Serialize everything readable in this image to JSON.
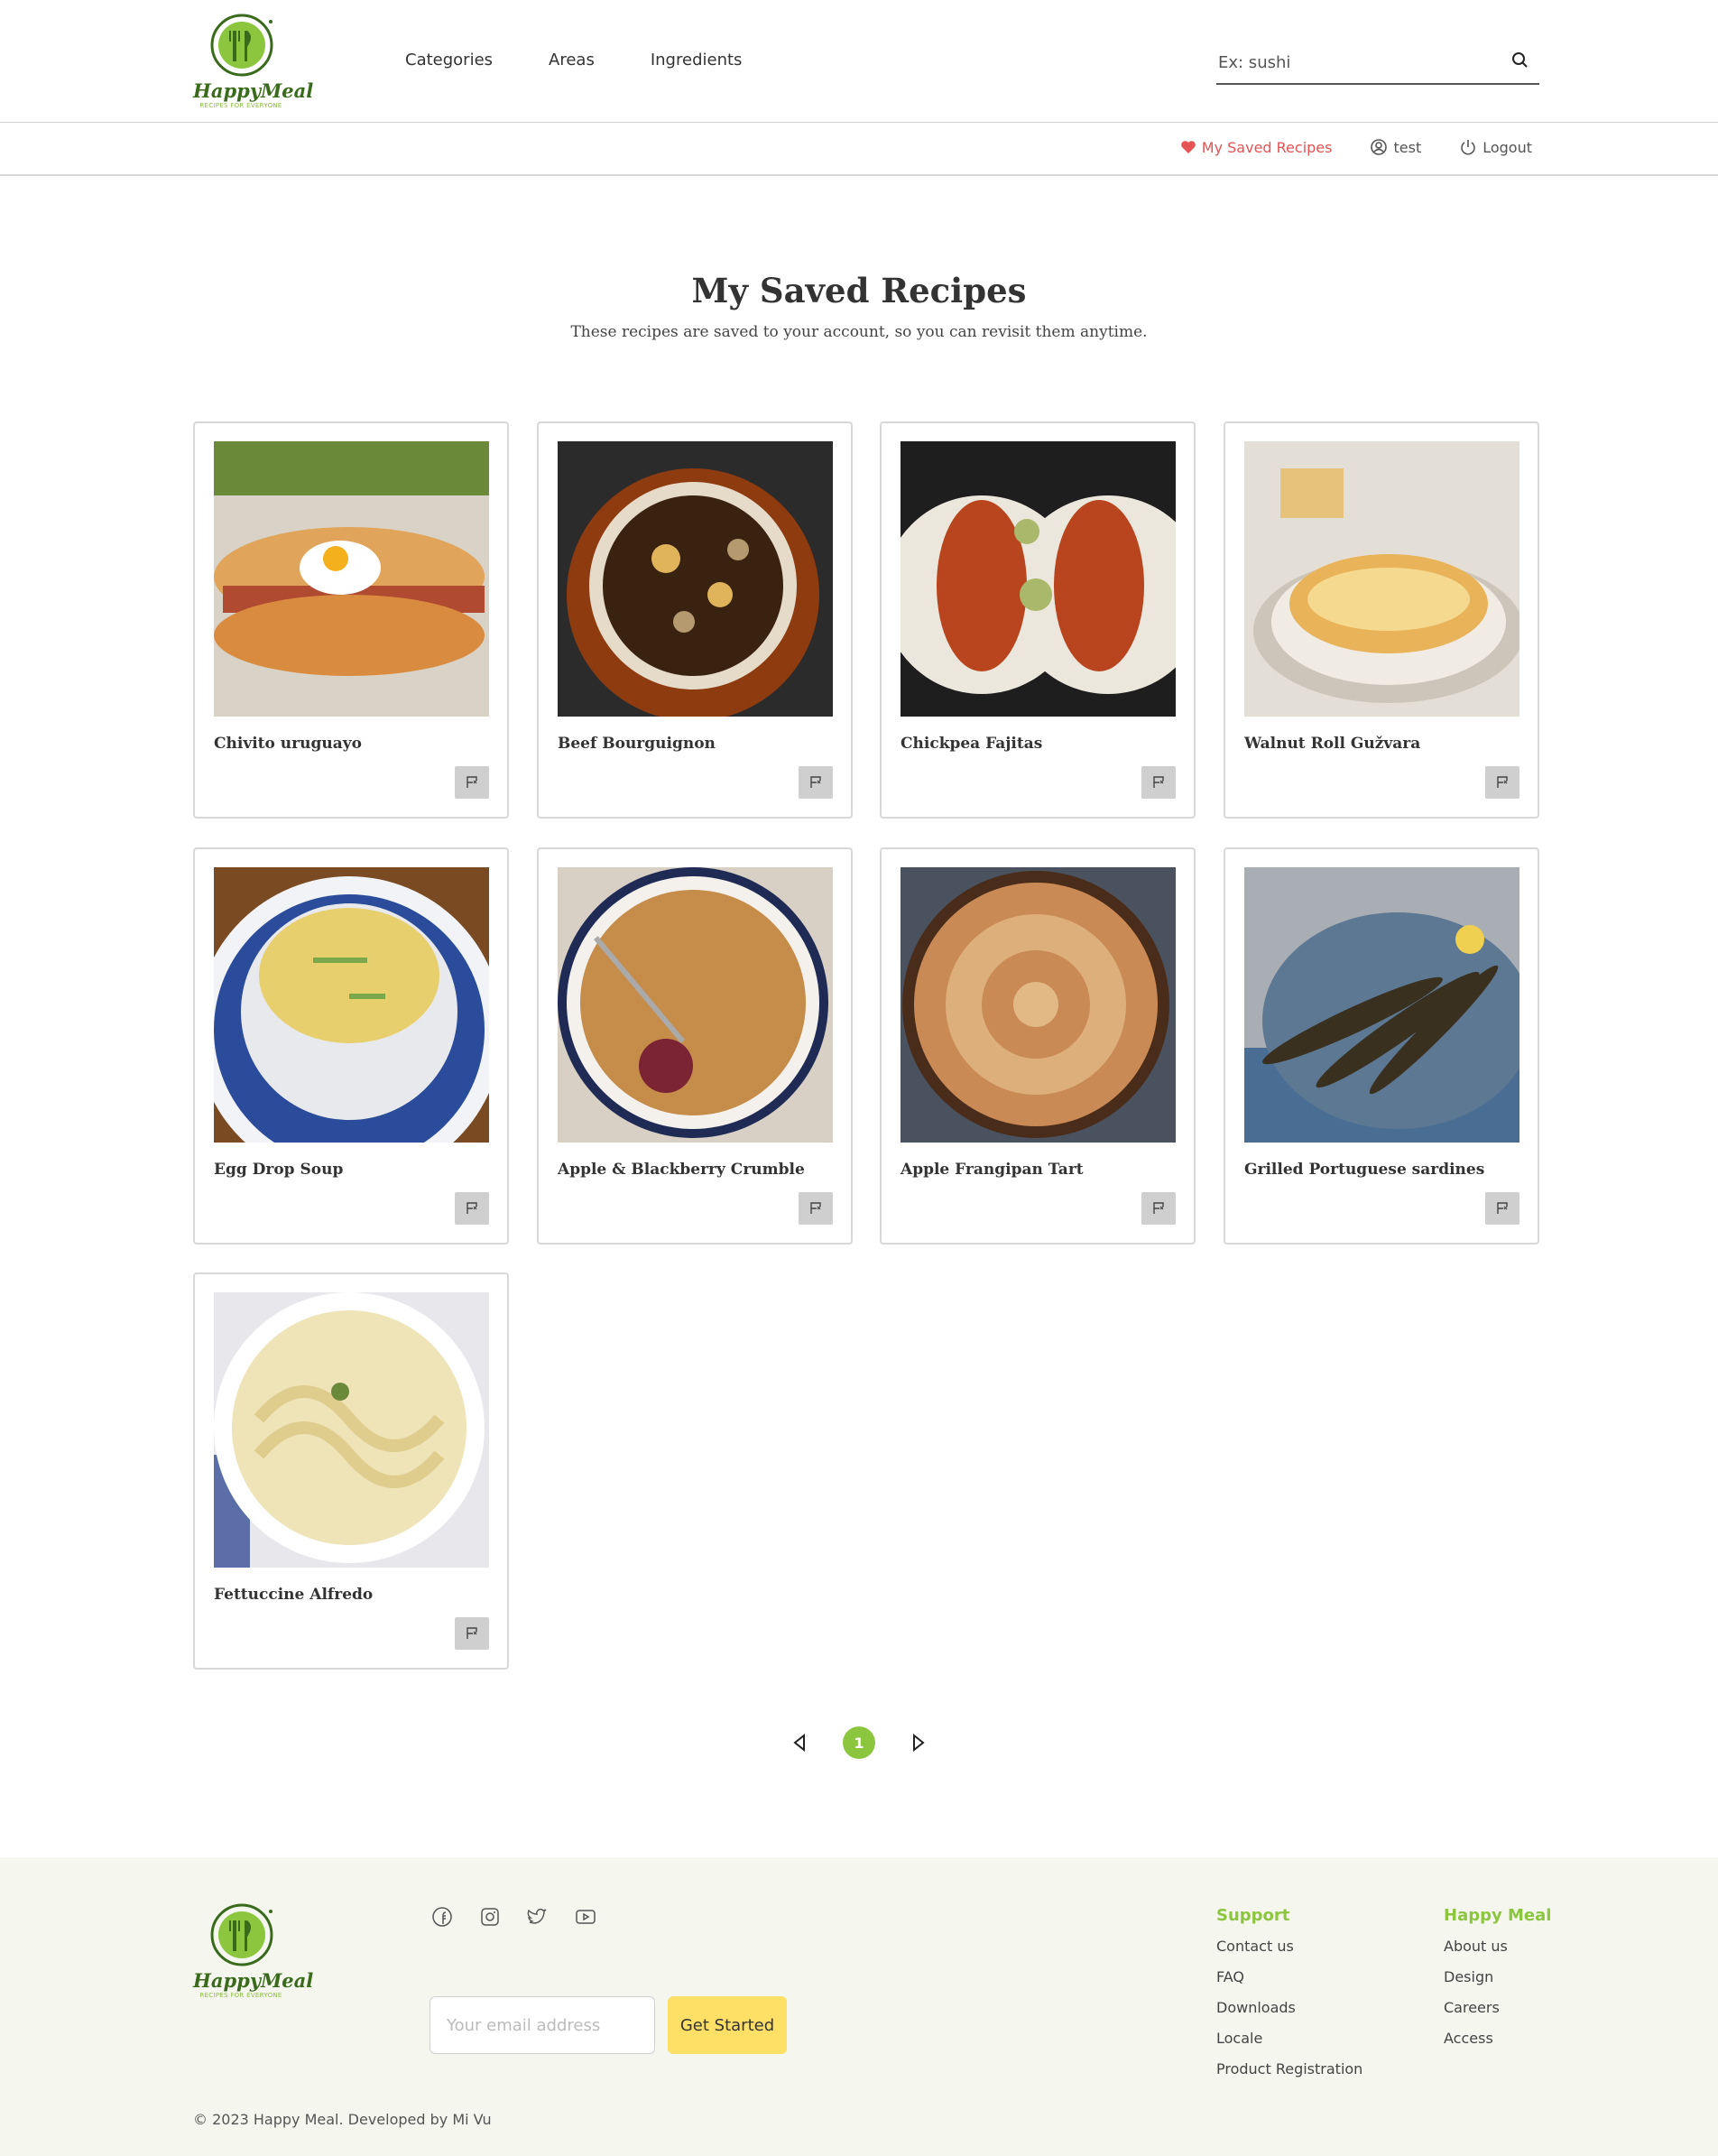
{
  "brand": {
    "name": "HappyMeal",
    "tagline": "RECIPES FOR EVERYONE"
  },
  "nav": [
    "Categories",
    "Areas",
    "Ingredients"
  ],
  "search": {
    "placeholder": "Ex: sushi"
  },
  "subnav": {
    "saved": "My Saved Recipes",
    "user": "test",
    "logout": "Logout"
  },
  "page": {
    "title": "My Saved Recipes",
    "subtitle": "These recipes are saved to your account, so you can revisit them anytime."
  },
  "recipes": [
    {
      "name": "Chivito uruguayo",
      "image": "sandwich"
    },
    {
      "name": "Beef Bourguignon",
      "image": "stew"
    },
    {
      "name": "Chickpea Fajitas",
      "image": "fajitas"
    },
    {
      "name": "Walnut Roll Gužvara",
      "image": "pastry"
    },
    {
      "name": "Egg Drop Soup",
      "image": "soup"
    },
    {
      "name": "Apple & Blackberry Crumble",
      "image": "crumble"
    },
    {
      "name": "Apple Frangipan Tart",
      "image": "tart"
    },
    {
      "name": "Grilled Portuguese sardines",
      "image": "sardines"
    },
    {
      "name": "Fettuccine Alfredo",
      "image": "pasta"
    }
  ],
  "pagination": {
    "current": "1"
  },
  "footer": {
    "email_placeholder": "Your email address",
    "cta": "Get Started",
    "support_title": "Support",
    "support_links": [
      "Contact us",
      "FAQ",
      "Downloads",
      "Locale",
      "Product Registration"
    ],
    "company_title": "Happy Meal",
    "company_links": [
      "About us",
      "Design",
      "Careers",
      "Access"
    ],
    "copyright": "© 2023 Happy Meal. Developed by Mi Vu",
    "socials": [
      "facebook-icon",
      "instagram-icon",
      "twitter-icon",
      "youtube-icon"
    ]
  },
  "colors": {
    "accent": "#8cc63f",
    "saved": "#e55353",
    "cta": "#ffe066",
    "footer_bg": "#f5f7ef"
  }
}
